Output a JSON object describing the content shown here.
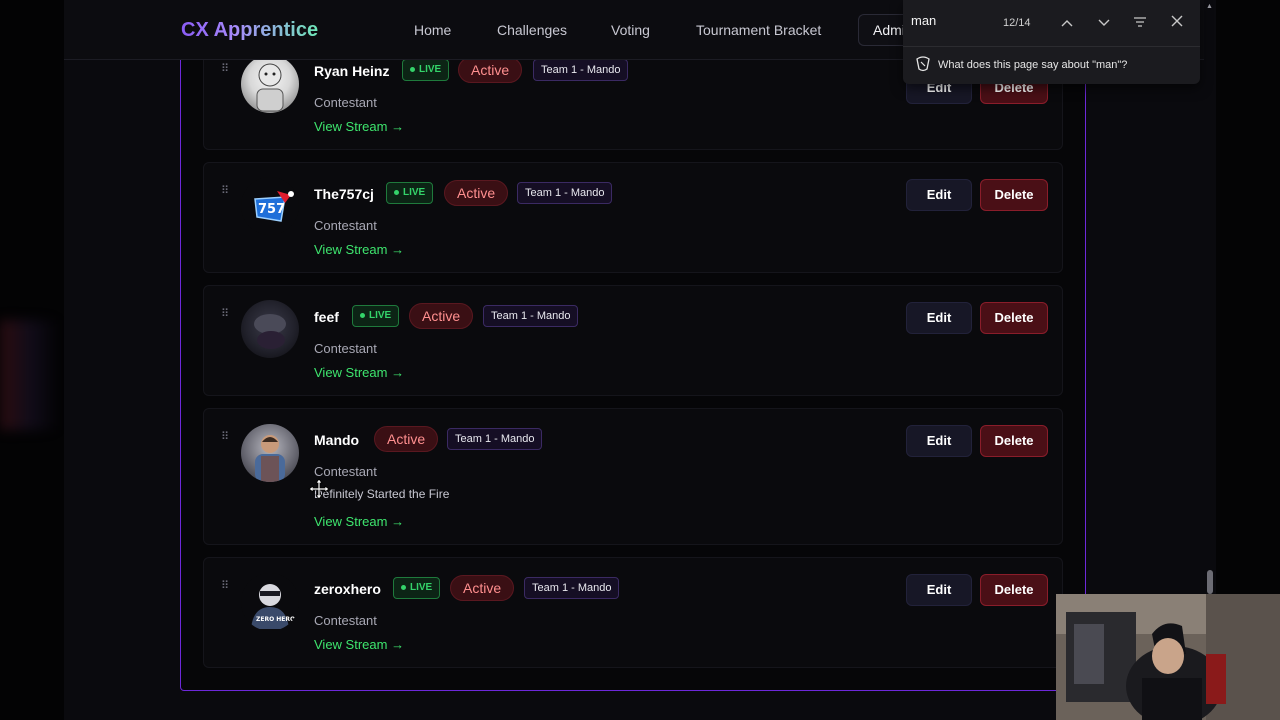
{
  "header": {
    "logo": "CX Apprentice",
    "nav": [
      "Home",
      "Challenges",
      "Voting",
      "Tournament Bracket"
    ],
    "admin_label": "Admin"
  },
  "find": {
    "query": "man",
    "count": "12/14",
    "ask": "What does this page say about \"man\"?"
  },
  "contestants": [
    {
      "name": "Ryan Heinz",
      "live": "LIVE",
      "status": "Active",
      "team": "Team 1 - Mando",
      "role": "Contestant",
      "description": "",
      "stream": "View Stream →",
      "edit": "Edit",
      "delete": "Delete"
    },
    {
      "name": "The757cj",
      "live": "LIVE",
      "status": "Active",
      "team": "Team 1 - Mando",
      "role": "Contestant",
      "description": "",
      "stream": "View Stream →",
      "edit": "Edit",
      "delete": "Delete"
    },
    {
      "name": "feef",
      "live": "LIVE",
      "status": "Active",
      "team": "Team 1 - Mando",
      "role": "Contestant",
      "description": "",
      "stream": "View Stream →",
      "edit": "Edit",
      "delete": "Delete"
    },
    {
      "name": "Mando",
      "live": "",
      "status": "Active",
      "team": "Team 1 - Mando",
      "role": "Contestant",
      "description": "Definitely Started the Fire",
      "stream": "View Stream →",
      "edit": "Edit",
      "delete": "Delete"
    },
    {
      "name": "zeroxhero",
      "live": "LIVE",
      "status": "Active",
      "team": "Team 1 - Mando",
      "role": "Contestant",
      "description": "",
      "stream": "View Stream →",
      "edit": "Edit",
      "delete": "Delete"
    }
  ],
  "colors": {
    "accent": "#8b5cf6",
    "live": "#34d36a",
    "active_badge": "#ff8f8f",
    "delete_bg": "#4a0f16",
    "stream_link": "#3ee56e"
  },
  "icons": [
    "drag-handle-icon",
    "chevron-up-icon",
    "chevron-down-icon",
    "filter-icon",
    "close-icon",
    "copilot-icon",
    "move-cursor-icon"
  ]
}
